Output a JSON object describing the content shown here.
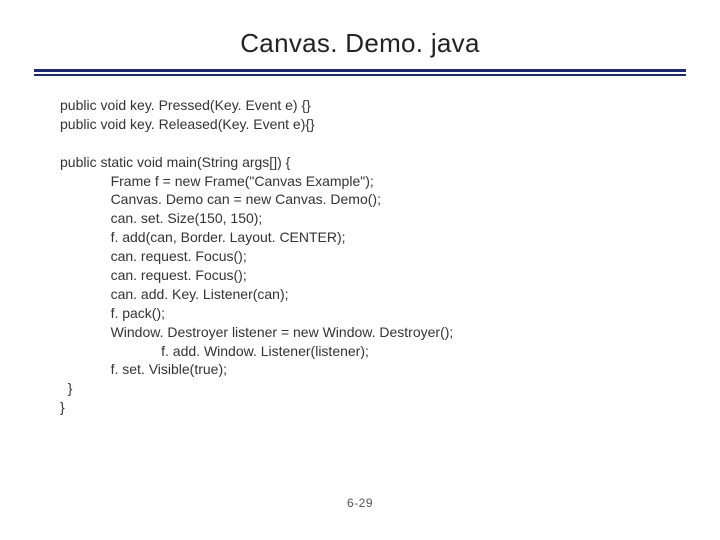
{
  "title": "Canvas. Demo. java",
  "code": "public void key. Pressed(Key. Event e) {}\npublic void key. Released(Key. Event e){}\n\npublic static void main(String args[]) {\n             Frame f = new Frame(\"Canvas Example\");\n             Canvas. Demo can = new Canvas. Demo();\n             can. set. Size(150, 150);\n             f. add(can, Border. Layout. CENTER);\n             can. request. Focus();\n             can. request. Focus();\n             can. add. Key. Listener(can);\n             f. pack();\n             Window. Destroyer listener = new Window. Destroyer();\n                          f. add. Window. Listener(listener);\n             f. set. Visible(true);\n  }\n}",
  "page_number": "6-29"
}
